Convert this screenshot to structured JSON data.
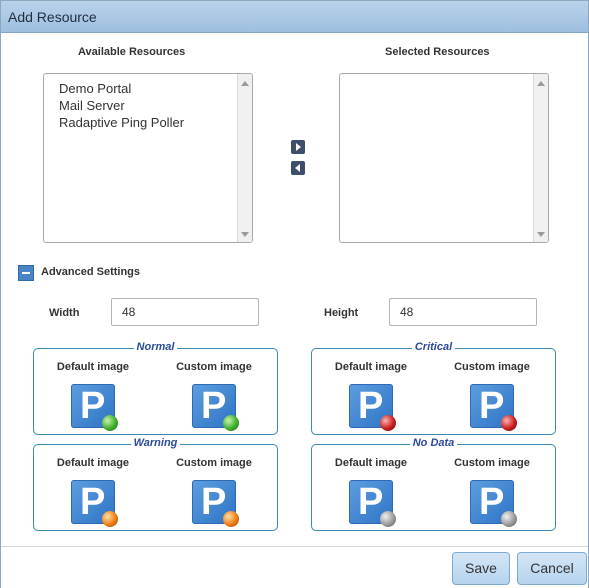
{
  "window": {
    "title": "Add Resource"
  },
  "available": {
    "header": "Available Resources",
    "items": [
      "Demo Portal",
      "Mail Server",
      "Radaptive Ping Poller"
    ]
  },
  "selected": {
    "header": "Selected Resources",
    "items": []
  },
  "move": {
    "right_icon": "arrow-right-icon",
    "left_icon": "arrow-left-icon"
  },
  "advanced": {
    "label": "Advanced Settings",
    "expanded": true
  },
  "fields": {
    "width_label": "Width",
    "width_value": "48",
    "height_label": "Height",
    "height_value": "48"
  },
  "groups": {
    "normal": {
      "title": "Normal",
      "default_label": "Default image",
      "custom_label": "Custom image",
      "status_color": "#3fae2a"
    },
    "critical": {
      "title": "Critical",
      "default_label": "Default image",
      "custom_label": "Custom image",
      "status_color": "#c81e1e"
    },
    "warning": {
      "title": "Warning",
      "default_label": "Default image",
      "custom_label": "Custom image",
      "status_color": "#f07c12"
    },
    "nodata": {
      "title": "No Data",
      "default_label": "Default image",
      "custom_label": "Custom image",
      "status_color": "#9a9a9a"
    }
  },
  "footer": {
    "save_label": "Save",
    "cancel_label": "Cancel"
  }
}
